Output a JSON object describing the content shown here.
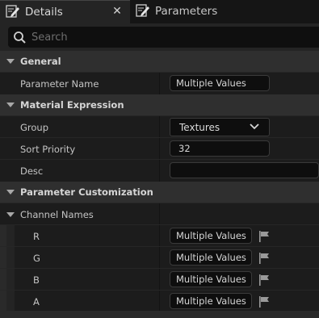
{
  "tabs": [
    {
      "label": "Details",
      "icon": "details-pencil-icon",
      "active": true
    },
    {
      "label": "Parameters",
      "icon": "parameters-pencil-icon",
      "active": false
    }
  ],
  "search": {
    "placeholder": "Search",
    "value": ""
  },
  "sections": {
    "general": {
      "title": "General",
      "rows": [
        {
          "label": "Parameter Name",
          "value": "Multiple Values"
        }
      ]
    },
    "material_expression": {
      "title": "Material Expression",
      "group": {
        "label": "Group",
        "value": "Textures"
      },
      "sort_priority": {
        "label": "Sort Priority",
        "value": "32"
      },
      "desc": {
        "label": "Desc",
        "value": ""
      }
    },
    "parameter_customization": {
      "title": "Parameter Customization",
      "channel_names": {
        "label": "Channel Names",
        "channels": [
          {
            "label": "R",
            "value": "Multiple Values"
          },
          {
            "label": "G",
            "value": "Multiple Values"
          },
          {
            "label": "B",
            "value": "Multiple Values"
          },
          {
            "label": "A",
            "value": "Multiple Values"
          }
        ]
      }
    }
  },
  "colors": {
    "panel": "#242424",
    "row": "#1c1c1c",
    "section": "#2f2f2f",
    "field": "#0e0e0e",
    "text": "#c4c4c4"
  }
}
